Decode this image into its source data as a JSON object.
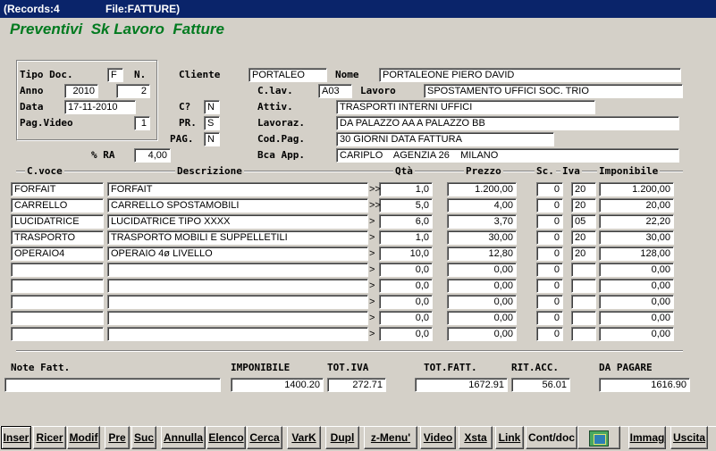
{
  "window": {
    "records": "(Records:4",
    "file": "File:FATTURE)"
  },
  "header": {
    "title": "Preventivi  Sk Lavoro  Fatture"
  },
  "doc": {
    "tipo_doc_label": "Tipo Doc.",
    "tipo_doc": "F",
    "n_label": "N.",
    "anno_label": "Anno",
    "anno": "2010",
    "numero": "2",
    "data_label": "Data",
    "data": "17-11-2010",
    "pag_video_label": "Pag.Video",
    "pag_video": "1",
    "ra_label": "% RA",
    "ra": "4,00"
  },
  "cliente": {
    "cliente_label": "Cliente",
    "cliente": "PORTALEO",
    "nome_label": "Nome",
    "nome": "PORTALEONE PIERO DAVID",
    "c_lav_label": "C.lav.",
    "c_lav": "A03",
    "lavoro_label": "Lavoro",
    "lavoro": "SPOSTAMENTO UFFICI SOC. TRIO",
    "c_label": "C?",
    "c": "N",
    "attiv_label": "Attiv.",
    "attiv": "TRASPORTI INTERNI UFFICI",
    "pr_label": "PR.",
    "pr": "S",
    "lavoraz_label": "Lavoraz.",
    "lavoraz": "DA PALAZZO AA A PALAZZO BB",
    "pag_label": "PAG.",
    "pag": "N",
    "cod_pag_label": "Cod.Pag.",
    "cod_pag": "30 GIORNI DATA FATTURA",
    "bca_label": "Bca App.",
    "bca": "CARIPLO    AGENZIA 26    MILANO"
  },
  "grid": {
    "headers": {
      "c_voce": "C.voce",
      "descrizione": "Descrizione",
      "qta": "Qtà",
      "prezzo": "Prezzo",
      "sc": "Sc.",
      "iva": "Iva",
      "imponibile": "Imponibile"
    },
    "rows": [
      {
        "c_voce": "FORFAIT",
        "descrizione": "FORFAIT",
        "mark": ">>",
        "qta": "1,0",
        "prezzo": "1.200,00",
        "sc": "0",
        "iva": "20",
        "imponibile": "1.200,00"
      },
      {
        "c_voce": "CARRELLO",
        "descrizione": "CARRELLO SPOSTAMOBILI",
        "mark": ">>",
        "qta": "5,0",
        "prezzo": "4,00",
        "sc": "0",
        "iva": "20",
        "imponibile": "20,00"
      },
      {
        "c_voce": "LUCIDATRICE",
        "descrizione": "LUCIDATRICE TIPO XXXX",
        "mark": ">",
        "qta": "6,0",
        "prezzo": "3,70",
        "sc": "0",
        "iva": "05",
        "imponibile": "22,20"
      },
      {
        "c_voce": "TRASPORTO",
        "descrizione": "TRASPORTO MOBILI E SUPPELLETILI",
        "mark": ">",
        "qta": "1,0",
        "prezzo": "30,00",
        "sc": "0",
        "iva": "20",
        "imponibile": "30,00"
      },
      {
        "c_voce": "OPERAIO4",
        "descrizione": "OPERAIO 4ø LIVELLO",
        "mark": ">",
        "qta": "10,0",
        "prezzo": "12,80",
        "sc": "0",
        "iva": "20",
        "imponibile": "128,00"
      },
      {
        "c_voce": "",
        "descrizione": "",
        "mark": ">",
        "qta": "0,0",
        "prezzo": "0,00",
        "sc": "0",
        "iva": "",
        "imponibile": "0,00"
      },
      {
        "c_voce": "",
        "descrizione": "",
        "mark": ">",
        "qta": "0,0",
        "prezzo": "0,00",
        "sc": "0",
        "iva": "",
        "imponibile": "0,00"
      },
      {
        "c_voce": "",
        "descrizione": "",
        "mark": ">",
        "qta": "0,0",
        "prezzo": "0,00",
        "sc": "0",
        "iva": "",
        "imponibile": "0,00"
      },
      {
        "c_voce": "",
        "descrizione": "",
        "mark": ">",
        "qta": "0,0",
        "prezzo": "0,00",
        "sc": "0",
        "iva": "",
        "imponibile": "0,00"
      },
      {
        "c_voce": "",
        "descrizione": "",
        "mark": ">",
        "qta": "0,0",
        "prezzo": "0,00",
        "sc": "0",
        "iva": "",
        "imponibile": "0,00"
      }
    ]
  },
  "totals": {
    "note_label": "Note Fatt.",
    "note": "",
    "imponibile_label": "IMPONIBILE",
    "imponibile": "1400.20",
    "tot_iva_label": "TOT.IVA",
    "tot_iva": "272.71",
    "tot_fatt_label": "TOT.FATT.",
    "tot_fatt": "1672.91",
    "rit_acc_label": "RIT.ACC.",
    "rit_acc": "56.01",
    "da_pagare_label": "DA PAGARE",
    "da_pagare": "1616.90"
  },
  "toolbar": {
    "inser": "Inser",
    "ricer": "Ricer",
    "modif": "Modif",
    "pre": "Pre",
    "suc": "Suc",
    "annulla": "Annulla",
    "elenco": "Elenco",
    "cerca": "Cerca",
    "vark": "VarK",
    "dupl": "Dupl",
    "zmenu": "z-Menu'",
    "video": "Video",
    "xsta": "Xsta",
    "link": "Link",
    "contdoc": "Cont/doc",
    "image_icon": "picture-icon",
    "immag": "Immag",
    "uscita": "Uscita"
  }
}
